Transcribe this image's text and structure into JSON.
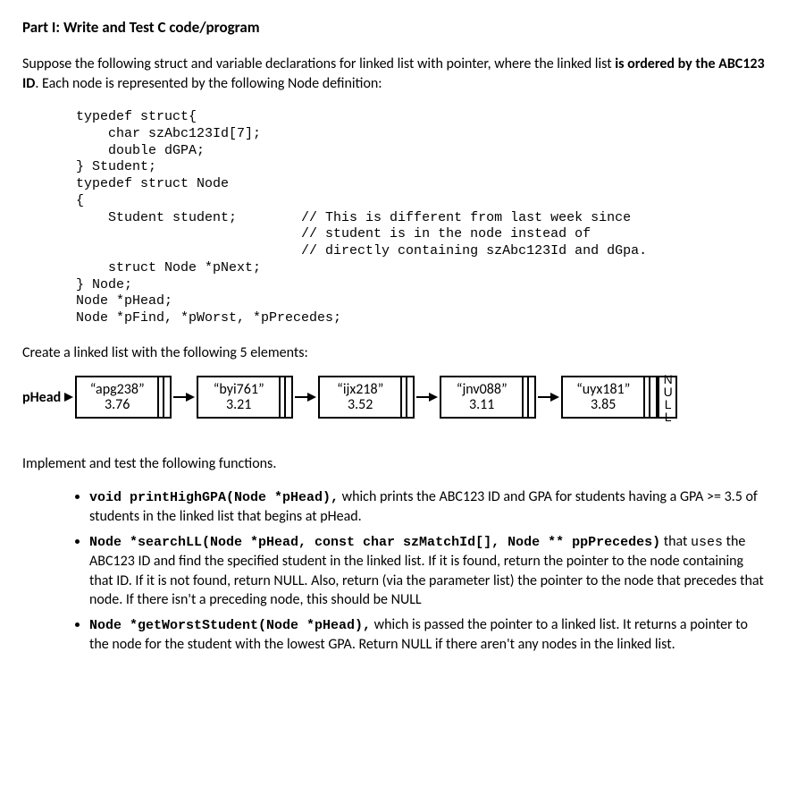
{
  "title": "Part I: Write and Test C code/program",
  "intro_1": "Suppose the following struct and variable declarations for linked list with pointer, where the linked list ",
  "intro_bold_1": "is ordered by the ABC123 ID",
  "intro_2": ". Each node is represented by the following Node definition:",
  "code": "typedef struct{\n    char szAbc123Id[7];\n    double dGPA;\n} Student;\ntypedef struct Node\n{\n    Student student;        // This is different from last week since\n                            // student is in the node instead of\n                            // directly containing szAbc123Id and dGpa.\n    struct Node *pNext;\n} Node;\nNode *pHead;\nNode *pFind, *pWorst, *pPrecedes;",
  "create_text": "Create a linked list with the following 5 elements:",
  "phead": "pHead",
  "nodes": [
    {
      "id": "“apg238”",
      "gpa": "3.76"
    },
    {
      "id": "“byi761”",
      "gpa": "3.21"
    },
    {
      "id": "“ijx218”",
      "gpa": "3.52"
    },
    {
      "id": "“jnv088”",
      "gpa": "3.11"
    },
    {
      "id": "“uyx181”",
      "gpa": "3.85"
    }
  ],
  "null_label": "NULL",
  "implement_text": "Implement and test the following functions.",
  "funcs": [
    {
      "sig": "void printHighGPA(Node *pHead),",
      "desc_1": " which prints the ABC123 ID and GPA for students having a GPA >= 3.5 of students in the linked list that begins at pHead."
    },
    {
      "sig": "Node *searchLL(Node *pHead, const char szMatchId[], Node ** ppPrecedes)",
      "desc_pre": " that ",
      "desc_mono": "uses",
      "desc_1": " the ABC123 ID and find the specified student in the linked list.  If it is found, return the pointer to the node containing that ID.  If it is not found, return NULL.  Also, return (via the parameter list) the pointer to the node that precedes that node.  If there isn't a preceding node, this should be NULL"
    },
    {
      "sig": "Node *getWorstStudent(Node *pHead),",
      "desc_1": "  which is passed the pointer to a linked list.  It returns a pointer to the node for the student with the lowest GPA.  Return NULL if there aren't any nodes in the linked list."
    }
  ]
}
